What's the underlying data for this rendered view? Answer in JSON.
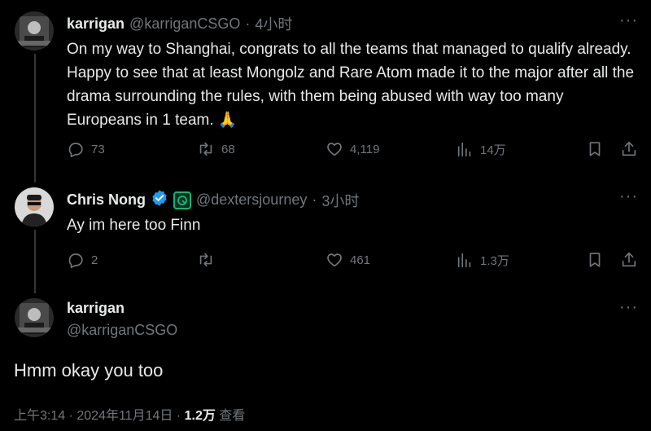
{
  "tweets": [
    {
      "name": "karrigan",
      "handle": "@karriganCSGO",
      "sep": "·",
      "time": "4小时",
      "text": "On my way to Shanghai, congrats to all the teams that managed to qualify already. Happy to see that at least Mongolz and Rare Atom made it to the major after all the drama surrounding the rules, with them being abused with way too many Europeans in 1 team. 🙏",
      "replies": "73",
      "reposts": "68",
      "likes": "4,119",
      "views": "14万"
    },
    {
      "name": "Chris Nong",
      "handle": "@dextersjourney",
      "sep": "·",
      "time": "3小时",
      "text": "Ay im here too Finn",
      "replies": "2",
      "reposts": "",
      "likes": "461",
      "views": "1.3万"
    }
  ],
  "main": {
    "name": "karrigan",
    "handle": "@karriganCSGO",
    "text": "Hmm okay you too",
    "footer_time": "上午3:14 · 2024年11月14日 · ",
    "footer_views": "1.2万",
    "footer_views_label": " 查看"
  },
  "more_label": "···",
  "colors": {
    "background": "#000000",
    "text": "#e7e9ea",
    "muted": "#71767b",
    "verified": "#1d9bf0",
    "affiliate": "#00ba7c"
  }
}
